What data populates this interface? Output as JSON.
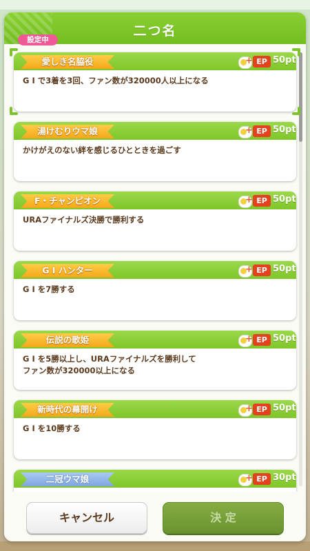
{
  "window": {
    "title": "二つ名"
  },
  "titles": [
    {
      "name": "愛しき名脇役",
      "ep": "EP",
      "points": "50pt",
      "description": "G I で3着を3回、ファン数が320000人以上になる",
      "selected": true
    },
    {
      "name": "湯けむりウマ娘",
      "ep": "EP",
      "points": "50pt",
      "description": "かけがえのない絆を感じるひとときを過ごす"
    },
    {
      "name": "F・チャンピオン",
      "ep": "EP",
      "points": "50pt",
      "description": "URAファイナルズ決勝で勝利する"
    },
    {
      "name": "G I ハンター",
      "ep": "EP",
      "points": "50pt",
      "description": "G I を7勝する"
    },
    {
      "name": "伝説の歌姫",
      "ep": "EP",
      "points": "50pt",
      "description": "G I を5勝以上し、URAファイナルズを勝利して\nファン数が320000以上になる"
    },
    {
      "name": "新時代の幕開け",
      "ep": "EP",
      "points": "50pt",
      "description": "G I を10勝する"
    },
    {
      "name": "二冠ウマ娘",
      "ep": "EP",
      "points": "30pt",
      "description": ""
    }
  ],
  "selected_badge": "設定中",
  "buttons": {
    "cancel": "キャンセル",
    "decide": "決 定"
  },
  "colors": {
    "header": "#7ec32b",
    "ribbon": "#f4a71b",
    "text": "#5b3a1d",
    "ep": "#e4411f",
    "badge": "#ef5a96"
  }
}
